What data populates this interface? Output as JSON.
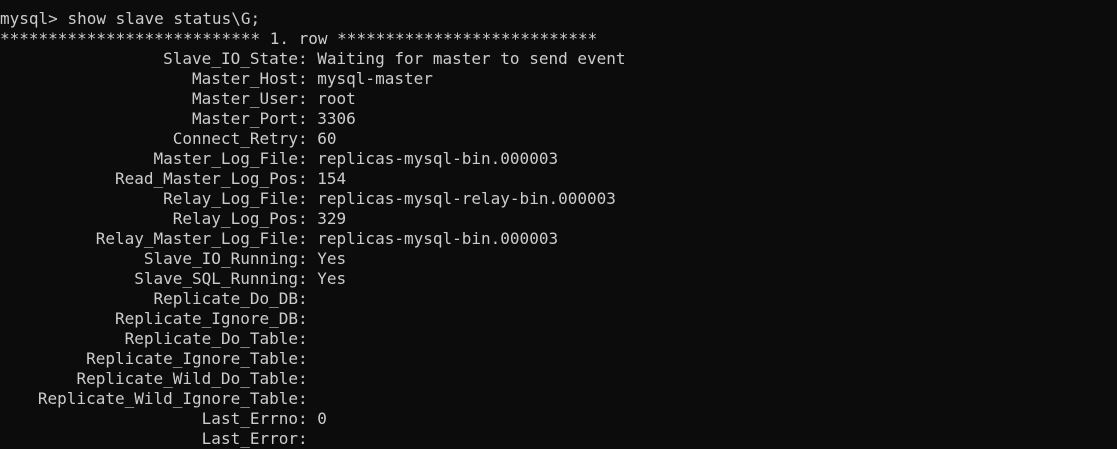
{
  "terminal": {
    "prompt": "mysql>",
    "command": "show slave status\\G;",
    "row_header": {
      "stars_left": "***************************",
      "row_label": "1. row",
      "stars_right": "***************************"
    },
    "fields": [
      {
        "key": "Slave_IO_State",
        "value": "Waiting for master to send event"
      },
      {
        "key": "Master_Host",
        "value": "mysql-master"
      },
      {
        "key": "Master_User",
        "value": "root"
      },
      {
        "key": "Master_Port",
        "value": "3306"
      },
      {
        "key": "Connect_Retry",
        "value": "60"
      },
      {
        "key": "Master_Log_File",
        "value": "replicas-mysql-bin.000003"
      },
      {
        "key": "Read_Master_Log_Pos",
        "value": "154"
      },
      {
        "key": "Relay_Log_File",
        "value": "replicas-mysql-relay-bin.000003"
      },
      {
        "key": "Relay_Log_Pos",
        "value": "329"
      },
      {
        "key": "Relay_Master_Log_File",
        "value": "replicas-mysql-bin.000003"
      },
      {
        "key": "Slave_IO_Running",
        "value": "Yes"
      },
      {
        "key": "Slave_SQL_Running",
        "value": "Yes"
      },
      {
        "key": "Replicate_Do_DB",
        "value": ""
      },
      {
        "key": "Replicate_Ignore_DB",
        "value": ""
      },
      {
        "key": "Replicate_Do_Table",
        "value": ""
      },
      {
        "key": "Replicate_Ignore_Table",
        "value": ""
      },
      {
        "key": "Replicate_Wild_Do_Table",
        "value": ""
      },
      {
        "key": "Replicate_Wild_Ignore_Table",
        "value": ""
      },
      {
        "key": "Last_Errno",
        "value": "0"
      },
      {
        "key": "Last_Error",
        "value": ""
      }
    ]
  },
  "colors": {
    "background": "#0c0c0c",
    "text": "#cccccc"
  }
}
